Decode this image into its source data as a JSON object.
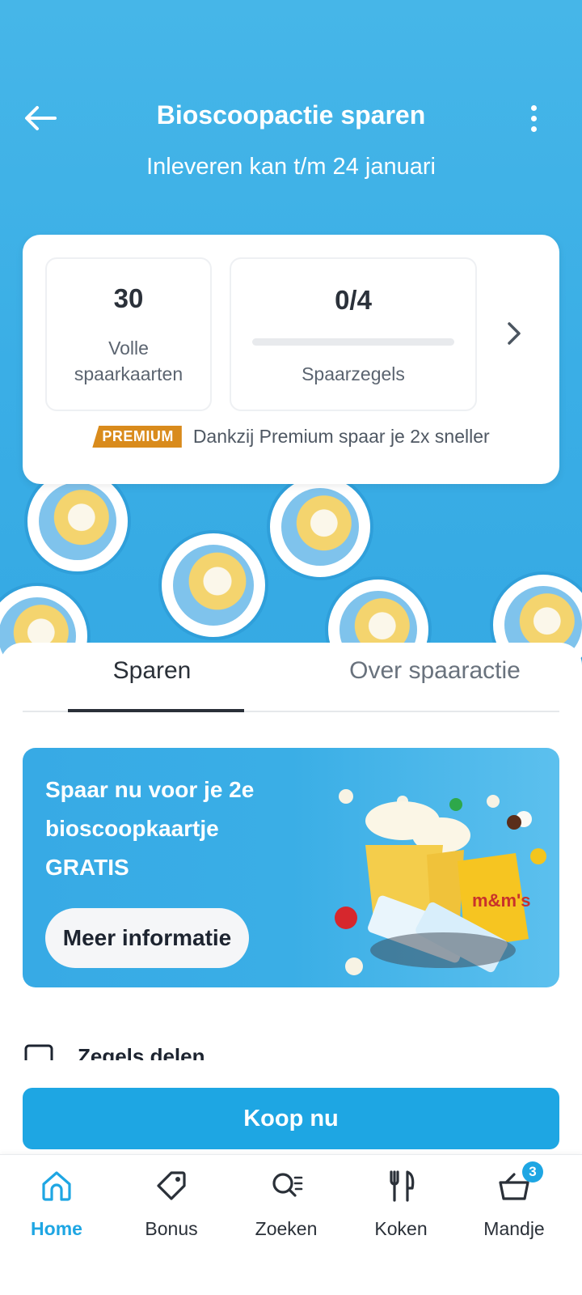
{
  "header": {
    "title": "Bioscoopactie sparen",
    "subtitle": "Inleveren kan t/m 24 januari"
  },
  "stamps": {
    "label": "Bioscoopzegel"
  },
  "stats": {
    "full_cards_value": "30",
    "full_cards_label_line1": "Volle",
    "full_cards_label_line2": "spaarkaarten",
    "stamps_value": "0/4",
    "stamps_progress": 0,
    "stamps_label": "Spaarzegels",
    "premium_badge": "PREMIUM",
    "premium_text": "Dankzij Premium spaar je 2x sneller"
  },
  "tabs": [
    {
      "label": "Sparen",
      "active": true
    },
    {
      "label": "Over spaaractie",
      "active": false
    }
  ],
  "promo": {
    "line1": "Spaar nu voor je 2e",
    "line2": "bioscoopkaartje",
    "line3": "GRATIS",
    "button": "Meer informatie"
  },
  "peek": {
    "label": "Zegels delen"
  },
  "buy": {
    "button": "Koop nu"
  },
  "bottom_nav": [
    {
      "label": "Home",
      "icon": "home-icon",
      "active": true
    },
    {
      "label": "Bonus",
      "icon": "tag-icon",
      "active": false
    },
    {
      "label": "Zoeken",
      "icon": "search-icon",
      "active": false
    },
    {
      "label": "Koken",
      "icon": "cutlery-icon",
      "active": false
    },
    {
      "label": "Mandje",
      "icon": "basket-icon",
      "active": false,
      "badge": "3"
    }
  ],
  "colors": {
    "brand_blue": "#1ea6e3",
    "hero_blue": "#3aaee6",
    "premium_orange": "#d98b1c"
  }
}
